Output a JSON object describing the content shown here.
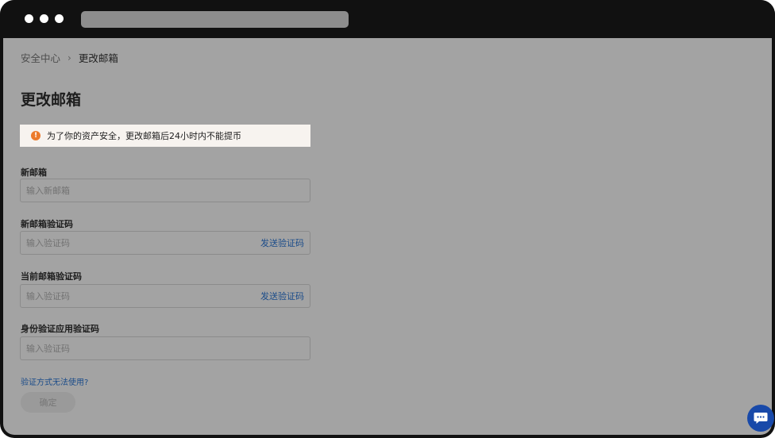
{
  "breadcrumb": {
    "parent": "安全中心",
    "separator": "›",
    "current": "更改邮箱"
  },
  "page": {
    "title": "更改邮箱"
  },
  "notice": {
    "icon": "warning-icon",
    "icon_glyph": "!",
    "text": "为了你的资产安全，更改邮箱后24小时内不能提币",
    "icon_color": "#ec7a2b"
  },
  "form": {
    "new_email": {
      "label": "新邮箱",
      "placeholder": "输入新邮箱",
      "value": ""
    },
    "new_email_code": {
      "label": "新邮箱验证码",
      "placeholder": "输入验证码",
      "value": "",
      "action": "发送验证码"
    },
    "current_email_code": {
      "label": "当前邮箱验证码",
      "placeholder": "输入验证码",
      "value": "",
      "action": "发送验证码"
    },
    "authenticator_code": {
      "label": "身份验证应用验证码",
      "placeholder": "输入验证码",
      "value": ""
    },
    "help_link": "验证方式无法使用?",
    "confirm_label": "确定"
  },
  "colors": {
    "link": "#1b4c8a",
    "chat_button": "#1849a9",
    "overlay": "#a3a3a3"
  },
  "chat": {
    "icon": "chat-bubble-icon"
  }
}
